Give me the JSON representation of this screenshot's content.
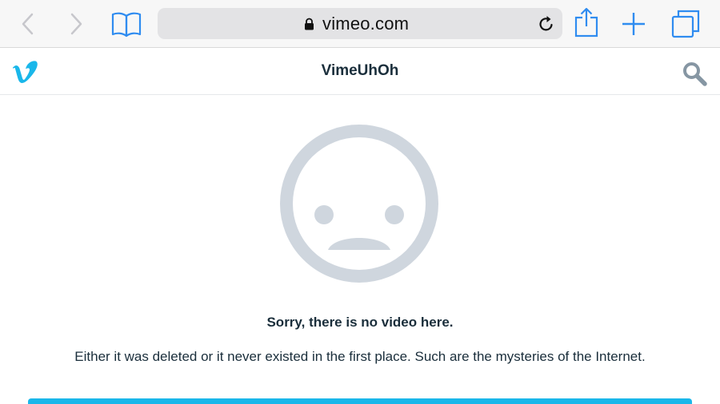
{
  "browser": {
    "url": "vimeo.com",
    "icons": [
      "back-icon",
      "forward-icon",
      "bookmarks-icon",
      "lock-icon",
      "reload-icon",
      "share-icon",
      "new-tab-icon",
      "tabs-icon"
    ],
    "accent_color": "#2f8cf0"
  },
  "header": {
    "title": "VimeUhOh",
    "logo_icon": "vimeo-logo",
    "search_icon": "search-icon",
    "brand_color": "#1ab7ea"
  },
  "error": {
    "icon": "sad-face-icon",
    "heading": "Sorry, there is no video here.",
    "message": "Either it was deleted or it never existed in the first place. Such are the mysteries of the Internet."
  }
}
